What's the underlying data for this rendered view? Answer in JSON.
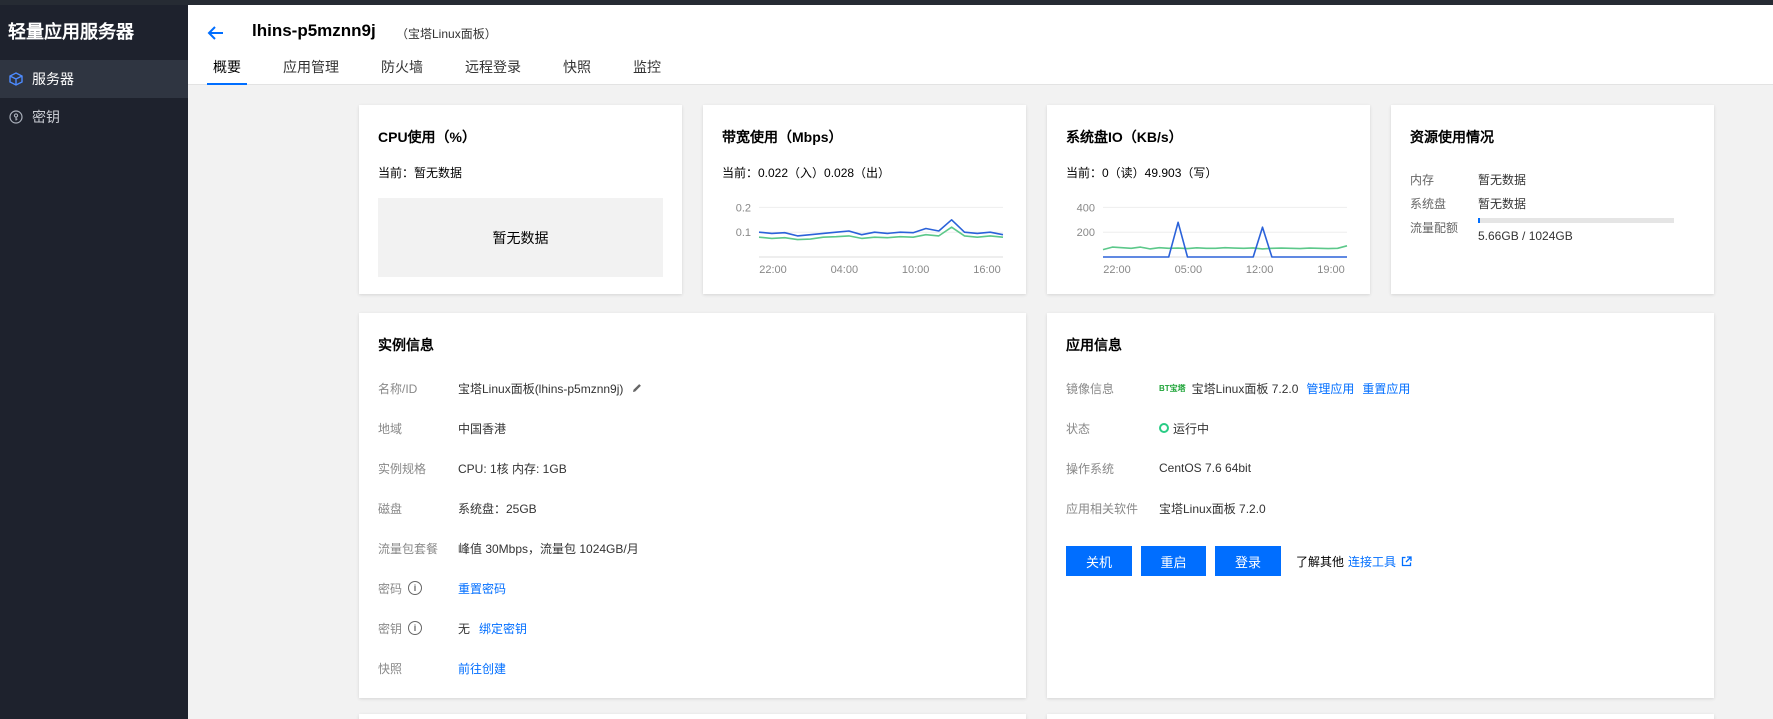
{
  "sidebar": {
    "app_title": "轻量应用服务器",
    "items": [
      {
        "label": "服务器",
        "icon": "cube-icon",
        "active": true
      },
      {
        "label": "密钥",
        "icon": "key-icon",
        "active": false
      }
    ]
  },
  "header": {
    "title": "lhins-p5mznn9j",
    "subtitle": "（宝塔Linux面板）",
    "tabs": [
      "概要",
      "应用管理",
      "防火墙",
      "远程登录",
      "快照",
      "监控"
    ],
    "active_tab": "概要"
  },
  "cpu": {
    "title": "CPU使用（%）",
    "current": "当前：暂无数据",
    "nodata": "暂无数据"
  },
  "bandwidth": {
    "title": "带宽使用（Mbps）",
    "current": "当前：0.022（入）0.028（出）"
  },
  "diskio": {
    "title": "系统盘IO（KB/s）",
    "current": "当前：0（读）49.903（写）"
  },
  "resources": {
    "title": "资源使用情况",
    "memory_label": "内存",
    "memory_value": "暂无数据",
    "disk_label": "系统盘",
    "disk_value": "暂无数据",
    "traffic_label": "流量配额",
    "traffic_value": "5.66GB / 1024GB",
    "traffic_fraction": 0.0055
  },
  "instance": {
    "title": "实例信息",
    "name_label": "名称/ID",
    "name_value": "宝塔Linux面板(lhins-p5mznn9j)",
    "region_label": "地域",
    "region_value": "中国香港",
    "spec_label": "实例规格",
    "spec_value": "CPU: 1核 内存: 1GB",
    "disk_label": "磁盘",
    "disk_value": "系统盘：25GB",
    "traffic_label": "流量包套餐",
    "traffic_value": "峰值 30Mbps，流量包 1024GB/月",
    "password_label": "密码",
    "password_link": "重置密码",
    "key_label": "密钥",
    "key_value": "无",
    "key_link": "绑定密钥",
    "snapshot_label": "快照",
    "snapshot_link": "前往创建"
  },
  "app": {
    "title": "应用信息",
    "image_label": "镜像信息",
    "image_logo": "BT宝塔",
    "image_value": "宝塔Linux面板 7.2.0",
    "manage_link": "管理应用",
    "reset_link": "重置应用",
    "status_label": "状态",
    "status_value": "运行中",
    "os_label": "操作系统",
    "os_value": "CentOS 7.6 64bit",
    "software_label": "应用相关软件",
    "software_value": "宝塔Linux面板 7.2.0",
    "btn_shutdown": "关机",
    "btn_restart": "重启",
    "btn_login": "登录",
    "learn_text": "了解其他",
    "learn_link": "连接工具"
  },
  "chart_data": [
    {
      "type": "line",
      "title": "带宽使用（Mbps）",
      "x_ticks": [
        "22:00",
        "04:00",
        "10:00",
        "16:00"
      ],
      "y_ticks": [
        "0.2",
        "0.1"
      ],
      "ylim": [
        0,
        0.25
      ],
      "series": [
        {
          "color": "#2b62d9",
          "values": [
            0.1,
            0.095,
            0.098,
            0.085,
            0.09,
            0.095,
            0.1,
            0.105,
            0.09,
            0.1,
            0.095,
            0.1,
            0.098,
            0.115,
            0.105,
            0.15,
            0.1,
            0.095,
            0.1,
            0.09
          ]
        },
        {
          "color": "#5cc88a",
          "values": [
            0.08,
            0.075,
            0.078,
            0.07,
            0.072,
            0.08,
            0.082,
            0.085,
            0.075,
            0.08,
            0.078,
            0.082,
            0.08,
            0.09,
            0.085,
            0.12,
            0.085,
            0.08,
            0.085,
            0.08
          ]
        }
      ]
    },
    {
      "type": "line",
      "title": "系统盘IO（KB/s）",
      "x_ticks": [
        "22:00",
        "05:00",
        "12:00",
        "19:00"
      ],
      "y_ticks": [
        "400",
        "200"
      ],
      "ylim": [
        0,
        500
      ],
      "series": [
        {
          "color": "#2b62d9",
          "values": [
            0,
            0,
            0,
            0,
            0,
            0,
            0,
            0,
            280,
            0,
            0,
            0,
            0,
            0,
            0,
            0,
            0,
            240,
            0,
            0,
            0,
            0,
            0,
            0,
            0,
            0,
            0
          ]
        },
        {
          "color": "#5cc88a",
          "values": [
            60,
            80,
            75,
            70,
            80,
            65,
            75,
            70,
            72,
            68,
            74,
            70,
            70,
            75,
            72,
            70,
            73,
            65,
            70,
            72,
            70,
            68,
            72,
            70,
            68,
            70,
            90
          ]
        }
      ]
    }
  ]
}
